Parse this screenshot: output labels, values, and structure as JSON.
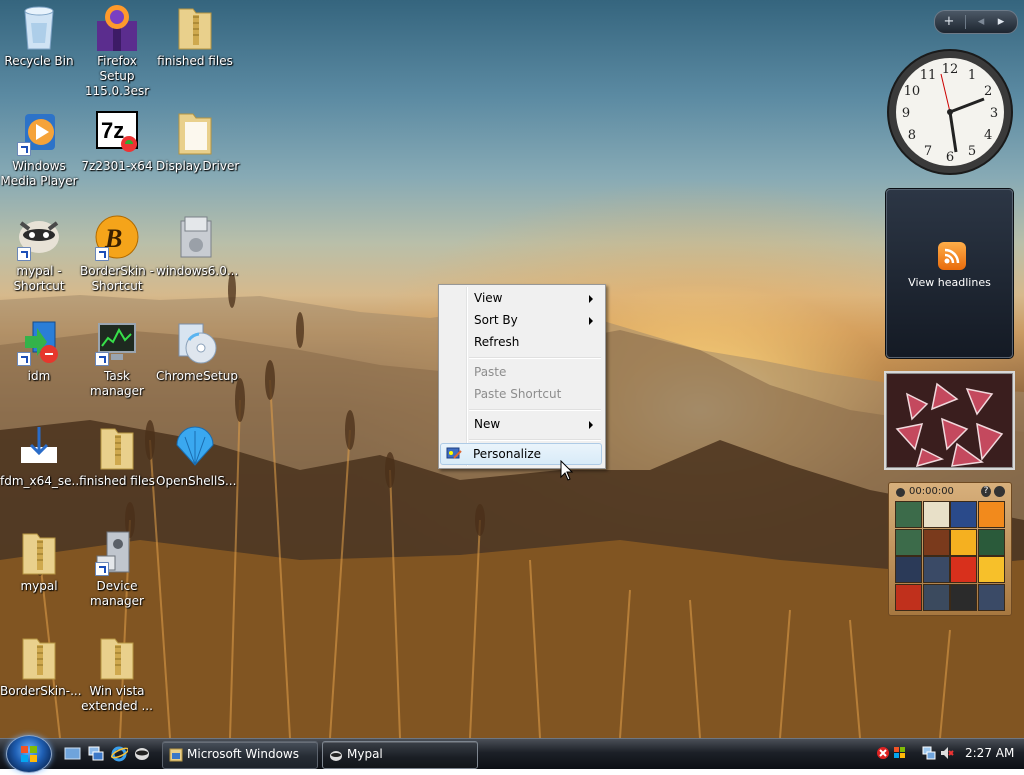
{
  "desktop": {
    "icons": [
      {
        "label": "Recycle Bin",
        "icon": "recycle-bin-icon"
      },
      {
        "label": "Firefox Setup 115.0.3esr",
        "icon": "firefox-setup-icon"
      },
      {
        "label": "finished files",
        "icon": "zip-folder-icon"
      },
      {
        "label": "Windows Media Player",
        "icon": "windows-media-player-icon"
      },
      {
        "label": "7z2301-x64",
        "icon": "7zip-icon"
      },
      {
        "label": "Display.Driver",
        "icon": "folder-icon"
      },
      {
        "label": "mypal - Shortcut",
        "icon": "mypal-raccoon-icon"
      },
      {
        "label": "BorderSkin - Shortcut",
        "icon": "borderskin-icon"
      },
      {
        "label": "windows6.0...",
        "icon": "installer-package-icon"
      },
      {
        "label": "idm",
        "icon": "idm-icon"
      },
      {
        "label": "Task manager",
        "icon": "task-manager-icon"
      },
      {
        "label": "ChromeSetup",
        "icon": "setup-cd-icon"
      },
      {
        "label": "fdm_x64_se...",
        "icon": "download-icon"
      },
      {
        "label": "finished files",
        "icon": "zip-folder-icon"
      },
      {
        "label": "OpenShellS...",
        "icon": "seashell-icon"
      },
      {
        "label": "mypal",
        "icon": "zip-folder-icon"
      },
      {
        "label": "Device manager",
        "icon": "device-manager-icon"
      },
      {
        "label": "BorderSkin-...",
        "icon": "zip-folder-icon"
      },
      {
        "label": "Win vista extended ...",
        "icon": "zip-folder-icon"
      }
    ]
  },
  "context_menu": {
    "items": [
      {
        "label": "View",
        "submenu": true,
        "disabled": false
      },
      {
        "label": "Sort By",
        "submenu": true,
        "disabled": false
      },
      {
        "label": "Refresh",
        "submenu": false,
        "disabled": false
      },
      {
        "label": "Paste",
        "submenu": false,
        "disabled": true
      },
      {
        "label": "Paste Shortcut",
        "submenu": false,
        "disabled": true
      },
      {
        "label": "New",
        "submenu": true,
        "disabled": false
      },
      {
        "label": "Personalize",
        "submenu": false,
        "disabled": false,
        "highlighted": true
      }
    ]
  },
  "gadgets": {
    "toolbar": {
      "add": "+",
      "prev": "◂",
      "next": "▸"
    },
    "clock": {
      "numbers": [
        "12",
        "1",
        "2",
        "3",
        "4",
        "5",
        "6",
        "7",
        "8",
        "9",
        "10",
        "11"
      ]
    },
    "feeds": {
      "label": "View headlines"
    },
    "puzzle": {
      "timer": "00:00:00",
      "help": "?"
    }
  },
  "taskbar": {
    "buttons": [
      {
        "label": "Microsoft Windows",
        "icon": "windows-explorer-icon",
        "active": false
      },
      {
        "label": "Mypal",
        "icon": "mypal-raccoon-icon",
        "active": true
      }
    ],
    "quick_launch": [
      "show-desktop-icon",
      "switch-windows-icon",
      "internet-explorer-icon",
      "mypal-raccoon-icon"
    ],
    "tray": {
      "time": "2:27 AM"
    }
  },
  "colors": {
    "menu_highlight": "#d8ebf8",
    "taskbar": "#1c2027",
    "accent": "#1f5fb3"
  }
}
